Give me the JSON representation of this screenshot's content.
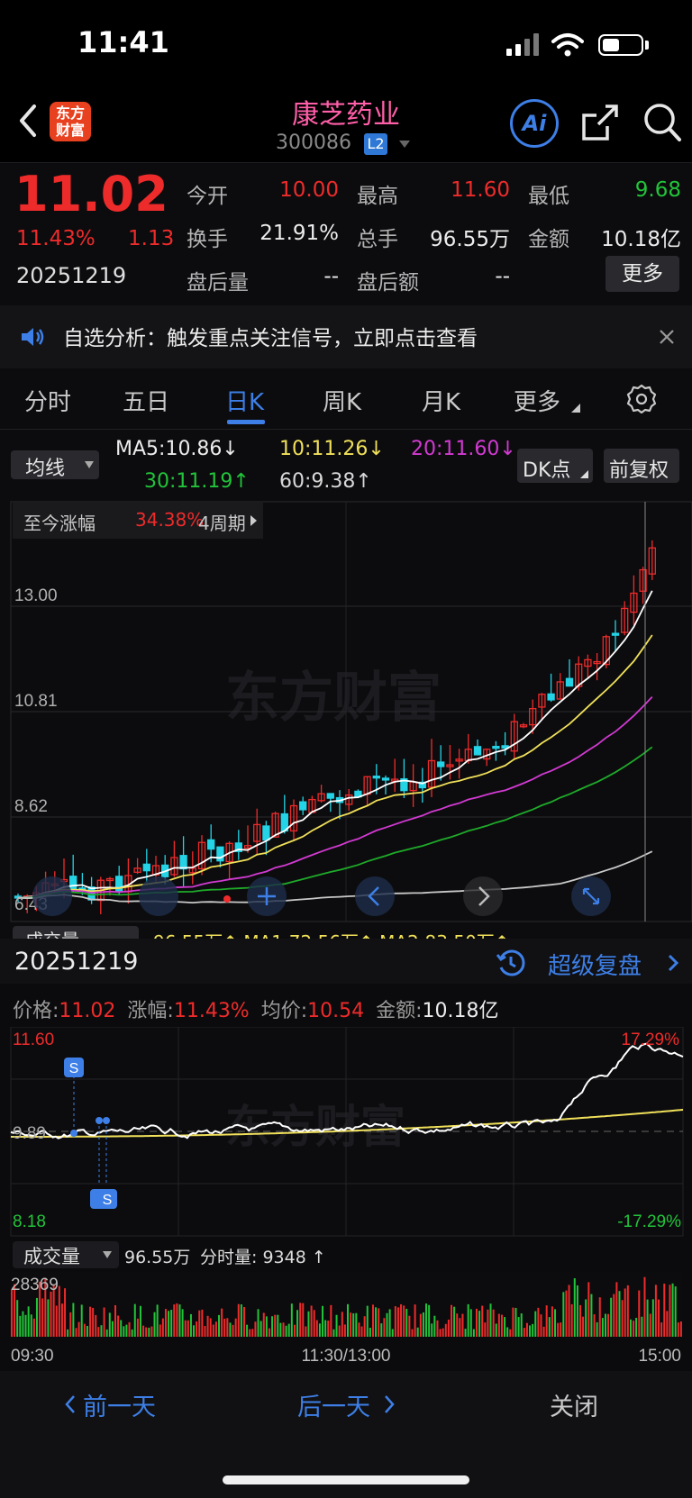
{
  "status_bar": {
    "time": "11:41"
  },
  "header": {
    "logo_text_top": "东方",
    "logo_text_bottom": "财富",
    "stock_name": "康芝药业",
    "stock_code": "300086",
    "level_badge": "L2",
    "ai_label": "Ai"
  },
  "quote": {
    "price": "11.02",
    "change_pct": "11.43%",
    "change": "1.13",
    "date": "20251219",
    "open_label": "今开",
    "open": "10.00",
    "high_label": "最高",
    "high": "11.60",
    "low_label": "最低",
    "low": "9.68",
    "turnover_label": "换手",
    "turnover": "21.91%",
    "volume_label": "总手",
    "volume": "96.55万",
    "amount_label": "金额",
    "amount": "10.18亿",
    "after_vol_label": "盘后量",
    "after_vol": "--",
    "after_amt_label": "盘后额",
    "after_amt": "--",
    "more_button": "更多"
  },
  "notice": {
    "text": "自选分析：触发重点关注信号，立即点击查看"
  },
  "tabs": [
    {
      "label": "分时"
    },
    {
      "label": "五日"
    },
    {
      "label": "日K"
    },
    {
      "label": "周K"
    },
    {
      "label": "月K"
    },
    {
      "label": "更多"
    }
  ],
  "ma_bar": {
    "selector": "均线",
    "ma5": "MA5:10.86↓",
    "ma10": "10:11.26↓",
    "ma20": "20:11.60↓",
    "ma30": "30:11.19↑",
    "ma60": "60:9.38↑",
    "dk_button": "DK点",
    "fq_button": "前复权"
  },
  "kline": {
    "period_label": "至今涨幅",
    "period_pct": "34.38%",
    "period_cycles": "4周期",
    "y_ticks": [
      "13.00",
      "10.81",
      "8.62",
      "6.43"
    ],
    "watermark": "东方财富",
    "volume_selector": "成交量",
    "volume_row": "96.55万↑  MA1:72.56万↑  MA2:83.50万↑",
    "colors": {
      "up": "#ee2b2b",
      "down": "#25d3e6",
      "ma5": "#ffffff",
      "ma10": "#f0e05a",
      "ma20": "#d23ad2",
      "ma30": "#1faa2a",
      "ma60": "#c8c8c8"
    }
  },
  "replay": {
    "date": "20251219",
    "title": "超级复盘",
    "price_label": "价格:",
    "price": "11.02",
    "pct_label": "涨幅:",
    "pct": "11.43%",
    "avg_label": "均价:",
    "avg": "10.54",
    "amount_label": "金额:",
    "amount": "10.18亿",
    "y_top": "11.60",
    "y_mid": "9.89",
    "y_bot": "8.18",
    "pct_top": "17.29%",
    "pct_bot": "-17.29%",
    "volume_selector": "成交量",
    "volume_total": "96.55万",
    "volume_per": "分时量: 9348 ↑",
    "volume_max": "28369",
    "time_start": "09:30",
    "time_mid": "11:30/13:00",
    "time_end": "15:00",
    "marker": "S"
  },
  "bottom_nav": {
    "prev": "前一天",
    "next": "后一天",
    "close": "关闭"
  }
}
